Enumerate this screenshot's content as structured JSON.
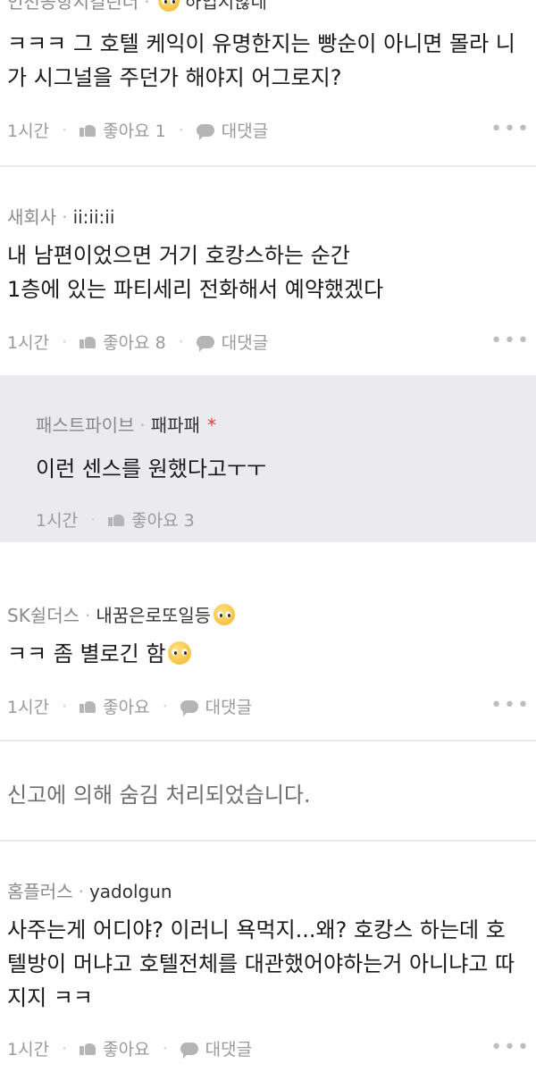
{
  "comments": [
    {
      "author": "인천공항지킬린더",
      "nick": "하입지않네",
      "lines": [
        "ㅋㅋㅋ 그 호텔 케익이 유명한지는 빵순이 아니면 몰라 니",
        "가 시그널을 주던가 해야지 어그로지?"
      ],
      "time": "1시간",
      "like": "좋아요 1",
      "reply": "대댓글",
      "more": "•••"
    },
    {
      "author": "새회사",
      "nick": "ii:ii:ii",
      "lines": [
        "내 남편이었으면 거기 호캉스하는 순간",
        "1층에 있는 파티세리 전화해서 예약했겠다"
      ],
      "time": "1시간",
      "like": "좋아요 8",
      "reply": "대댓글",
      "more": "•••"
    },
    {
      "author": "패스트파이브",
      "nick": "패파패",
      "star": "*",
      "lines": [
        "이런 센스를 원했다고ㅜㅜ"
      ],
      "time": "1시간",
      "like": "좋아요 3"
    },
    {
      "author": "SK쉴더스",
      "nick": "내꿈은로또일등",
      "lines": [
        "ㅋㅋ 좀 별로긴 함"
      ],
      "time": "1시간",
      "like": "좋아요",
      "reply": "대댓글",
      "more": "•••"
    },
    {
      "hidden": "신고에 의해 숨김 처리되었습니다."
    },
    {
      "author": "홈플러스",
      "nick": "yadolgun",
      "lines": [
        "사주는게 어디야? 이러니 욕먹지...왜? 호캉스 하는데 호",
        "텔방이 머냐고 호텔전체를 대관했어야하는거 아니냐고 따",
        "지지 ㅋㅋ"
      ],
      "time": "1시간",
      "like": "좋아요",
      "reply": "대댓글",
      "more": "•••"
    }
  ]
}
